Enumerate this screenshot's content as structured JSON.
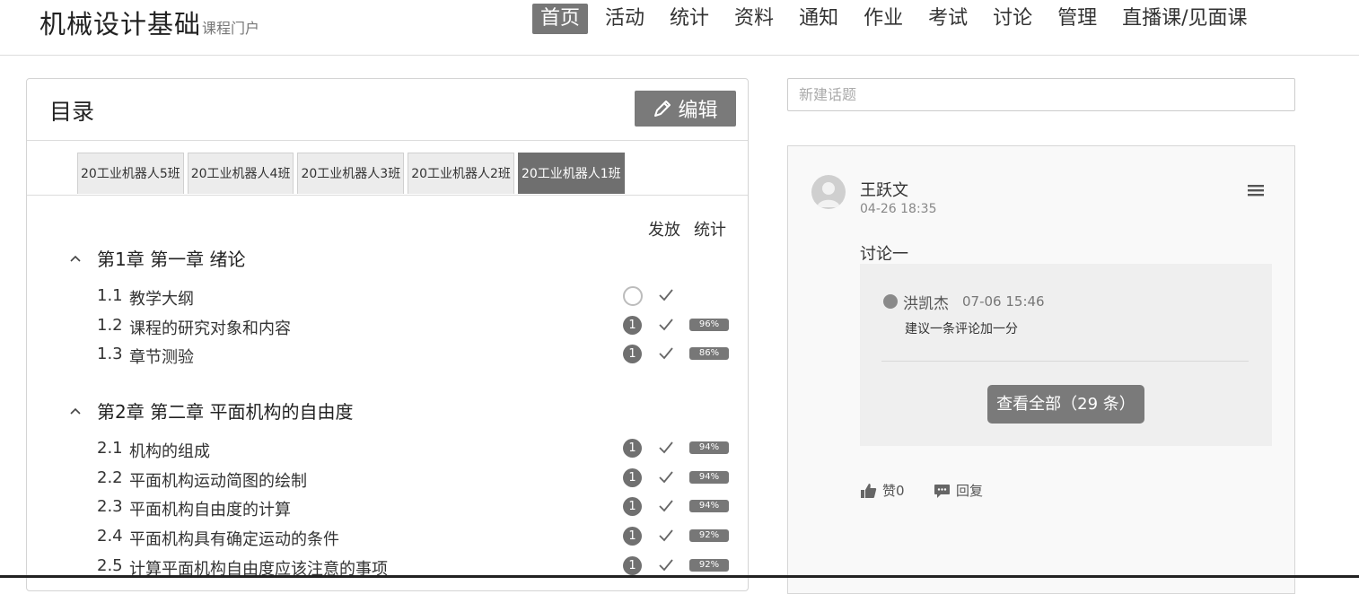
{
  "header": {
    "title": "机械设计基础",
    "subtitle": "课程门户",
    "nav": [
      {
        "label": "首页",
        "active": true
      },
      {
        "label": "活动",
        "active": false
      },
      {
        "label": "统计",
        "active": false
      },
      {
        "label": "资料",
        "active": false
      },
      {
        "label": "通知",
        "active": false
      },
      {
        "label": "作业",
        "active": false
      },
      {
        "label": "考试",
        "active": false
      },
      {
        "label": "讨论",
        "active": false
      },
      {
        "label": "管理",
        "active": false
      },
      {
        "label": "直播课/见面课",
        "active": false
      }
    ]
  },
  "catalog": {
    "title": "目录",
    "edit_label": "编辑",
    "tabs": [
      {
        "label": "20工业机器人5班",
        "active": false
      },
      {
        "label": "20工业机器人4班",
        "active": false
      },
      {
        "label": "20工业机器人3班",
        "active": false
      },
      {
        "label": "20工业机器人2班",
        "active": false
      },
      {
        "label": "20工业机器人1班",
        "active": true
      }
    ],
    "col_release": "发放",
    "col_stats": "统计",
    "chapters": [
      {
        "title": "第1章 第一章 绪论",
        "items": [
          {
            "num": "1.1",
            "name": "教学大纲",
            "badge": "",
            "pct": ""
          },
          {
            "num": "1.2",
            "name": "课程的研究对象和内容",
            "badge": "1",
            "pct": "96%"
          },
          {
            "num": "1.3",
            "name": "章节测验",
            "badge": "1",
            "pct": "86%"
          }
        ]
      },
      {
        "title": "第2章 第二章 平面机构的自由度",
        "items": [
          {
            "num": "2.1",
            "name": "机构的组成",
            "badge": "1",
            "pct": "94%"
          },
          {
            "num": "2.2",
            "name": "平面机构运动简图的绘制",
            "badge": "1",
            "pct": "94%"
          },
          {
            "num": "2.3",
            "name": "平面机构自由度的计算",
            "badge": "1",
            "pct": "94%"
          },
          {
            "num": "2.4",
            "name": "平面机构具有确定运动的条件",
            "badge": "1",
            "pct": "92%"
          },
          {
            "num": "2.5",
            "name": "计算平面机构自由度应该注意的事项",
            "badge": "1",
            "pct": "92%"
          }
        ]
      }
    ]
  },
  "discussion": {
    "new_topic_placeholder": "新建话题",
    "post": {
      "author": "王跃文",
      "time": "04-26 18:35",
      "text": "讨论一",
      "reply": {
        "author": "洪凯杰",
        "time": "07-06 15:46",
        "text": "建议一条评论加一分"
      },
      "view_all": "查看全部（29 条）",
      "like_label": "赞0",
      "reply_label": "回复"
    }
  },
  "icons": {
    "edit": "pencil-icon",
    "chevron": "chevron-up-icon",
    "check": "check-icon",
    "menu": "hamburger-menu-icon",
    "like": "thumbs-up-icon",
    "reply": "comment-icon"
  }
}
